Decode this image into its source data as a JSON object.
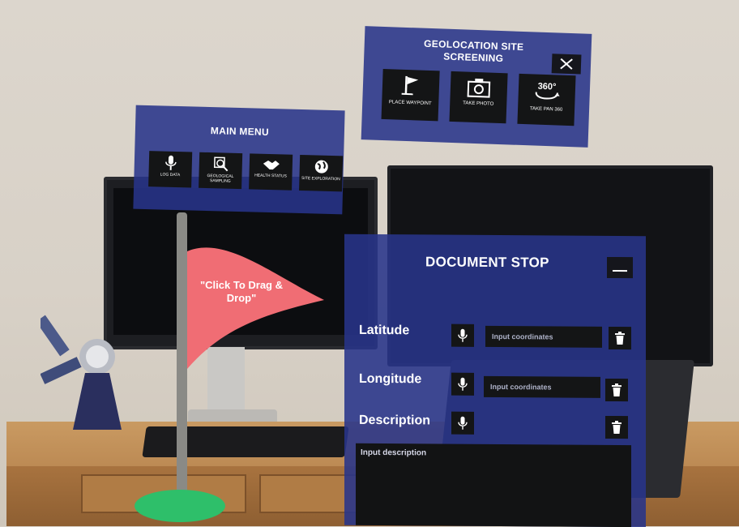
{
  "geolocation_panel": {
    "title": "GEOLOCATION SITE SCREENING",
    "buttons": [
      {
        "label": "PLACE WAYPOINT",
        "icon": "flag-icon"
      },
      {
        "label": "TAKE PHOTO",
        "icon": "camera-icon"
      },
      {
        "label": "TAKE PAN 360",
        "icon": "rotate-360-icon",
        "badge": "360°"
      }
    ],
    "close_icon": "close-icon"
  },
  "main_menu": {
    "title": "MAIN MENU",
    "buttons": [
      {
        "label": "LOG DATA",
        "icon": "microphone-icon"
      },
      {
        "label": "GEOLOGICAL SAMPLING",
        "icon": "magnifier-icon"
      },
      {
        "label": "HEALTH STATUS",
        "icon": "handshake-icon"
      },
      {
        "label": "SITE EXPLORATION",
        "icon": "globe-icon"
      }
    ]
  },
  "document_stop": {
    "title": "DOCUMENT STOP",
    "latitude": {
      "label": "Latitude",
      "placeholder": "Input coordinates"
    },
    "longitude": {
      "label": "Longitude",
      "placeholder": "Input coordinates"
    },
    "description": {
      "label": "Description",
      "placeholder": "Input description"
    }
  },
  "waypoint_flag": {
    "text": "\"Click To Drag & Drop\"",
    "flag_color": "#f06d74",
    "base_color": "#2ebf6a"
  },
  "colors": {
    "panel": "#28348a",
    "button": "#141516",
    "text": "#ffffff"
  }
}
